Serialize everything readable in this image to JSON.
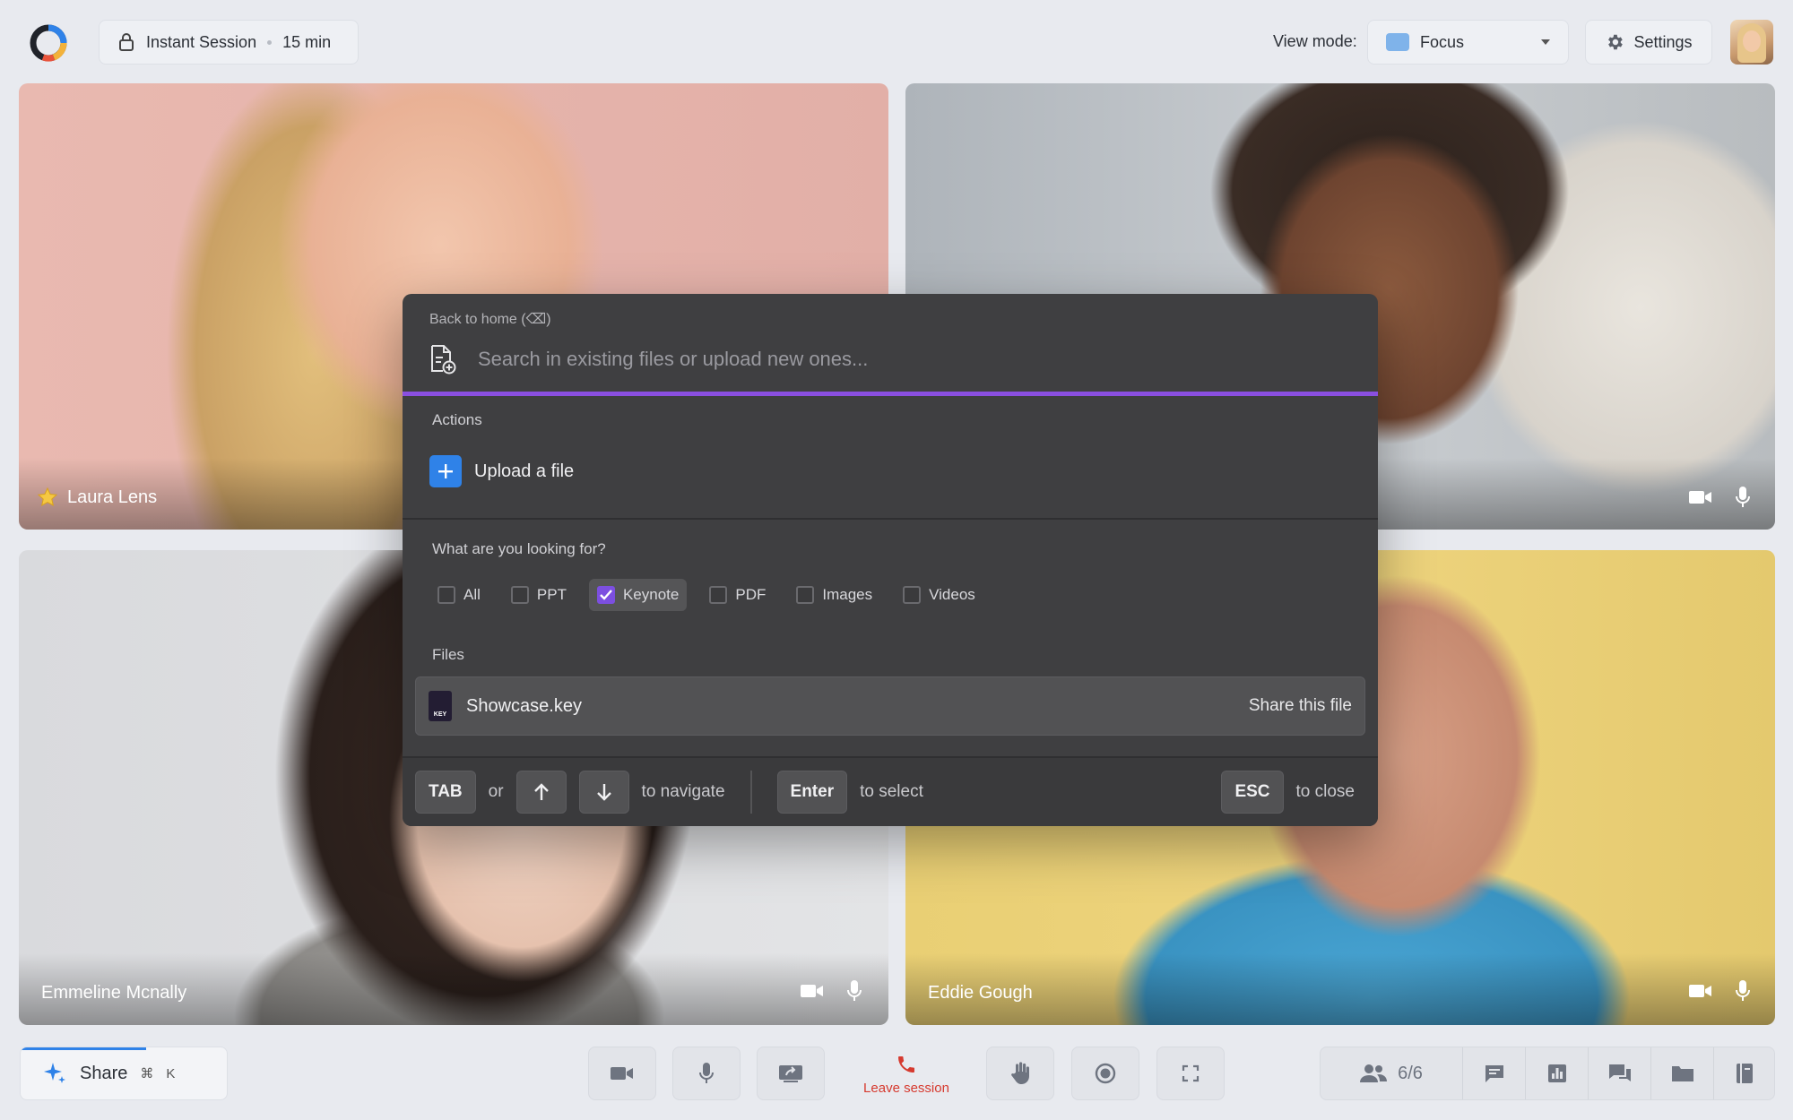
{
  "header": {
    "session_title": "Instant Session",
    "session_duration": "15 min",
    "view_mode_label": "View mode:",
    "view_mode_value": "Focus",
    "settings_label": "Settings"
  },
  "participants": [
    {
      "name": "Laura Lens",
      "starred": true
    },
    {
      "name": ""
    },
    {
      "name": "Emmeline Mcnally"
    },
    {
      "name": "Eddie Gough"
    }
  ],
  "modal": {
    "back_label": "Back to home (⌫)",
    "search_placeholder": "Search in existing files or upload new ones...",
    "actions_label": "Actions",
    "upload_label": "Upload a file",
    "filter_question": "What are you looking for?",
    "filters": [
      {
        "label": "All",
        "checked": false
      },
      {
        "label": "PPT",
        "checked": false
      },
      {
        "label": "Keynote",
        "checked": true
      },
      {
        "label": "PDF",
        "checked": false
      },
      {
        "label": "Images",
        "checked": false
      },
      {
        "label": "Videos",
        "checked": false
      }
    ],
    "files_label": "Files",
    "files": [
      {
        "name": "Showcase.key",
        "badge": "KEY",
        "action": "Share this file"
      }
    ],
    "footer": {
      "tab_key": "TAB",
      "or_text": "or",
      "navigate_text": "to navigate",
      "enter_key": "Enter",
      "select_text": "to select",
      "esc_key": "ESC",
      "close_text": "to close"
    }
  },
  "bottom_bar": {
    "share_label": "Share",
    "shortcut_cmd": "⌘",
    "shortcut_key": "K",
    "leave_label": "Leave session",
    "participant_count": "6/6"
  },
  "colors": {
    "accent_purple": "#8a4fe0",
    "upload_blue": "#2f82e8",
    "leave_red": "#d63a2f"
  }
}
